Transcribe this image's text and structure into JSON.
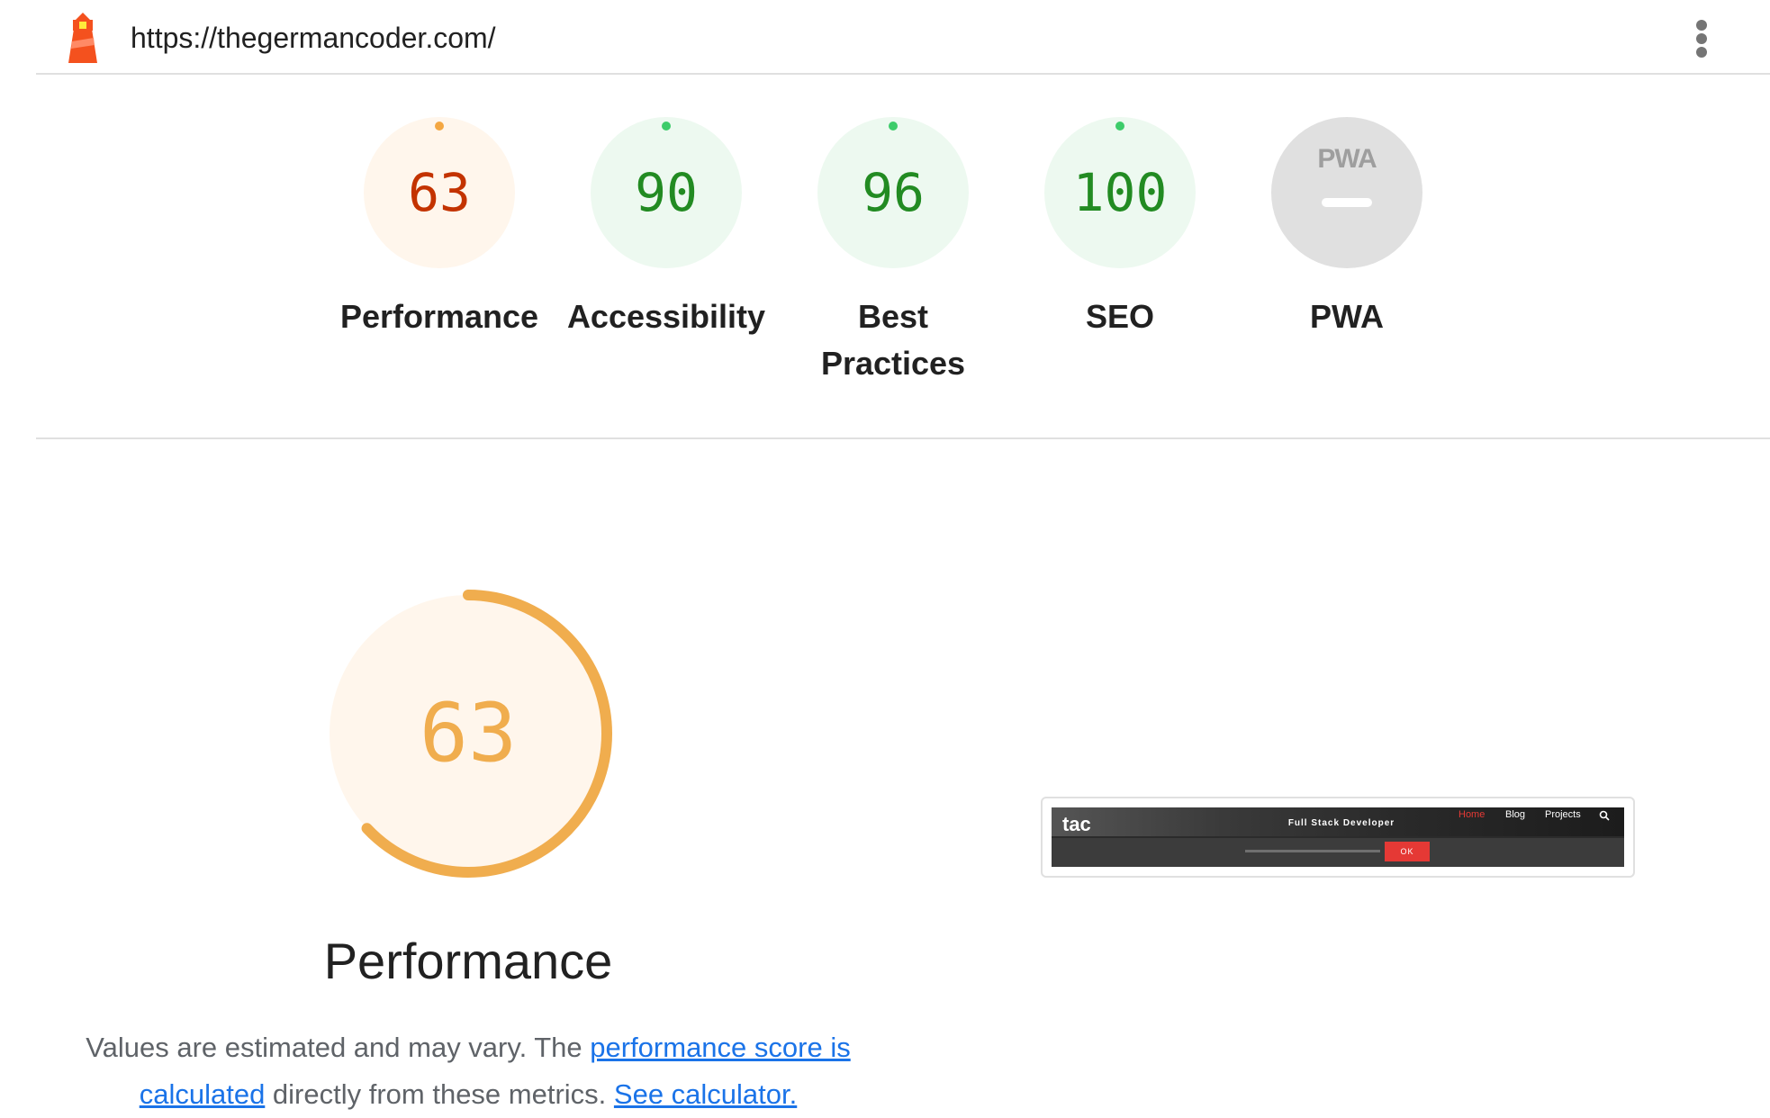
{
  "header": {
    "url": "https://thegermancoder.com/",
    "logo_icon": "lighthouse-icon",
    "menu_icon": "more-vert-icon"
  },
  "categories": [
    {
      "key": "performance",
      "score": "63",
      "label": "Performance",
      "status": "average",
      "color": "#c33300",
      "dot": "#f4a742",
      "bg": "#fff6ec"
    },
    {
      "key": "accessibility",
      "score": "90",
      "label": "Accessibility",
      "status": "pass",
      "color": "#228b22",
      "dot": "#3dcc6a",
      "bg": "#edf9f0"
    },
    {
      "key": "best-practices",
      "score": "96",
      "label": "Best Practices",
      "status": "pass",
      "color": "#228b22",
      "dot": "#3dcc6a",
      "bg": "#edf9f0"
    },
    {
      "key": "seo",
      "score": "100",
      "label": "SEO",
      "status": "pass",
      "color": "#228b22",
      "dot": "#3dcc6a",
      "bg": "#edf9f0"
    },
    {
      "key": "pwa",
      "score": "",
      "label": "PWA",
      "badge_text": "PWA",
      "status": "na",
      "bg": "#e0e0e0"
    }
  ],
  "performance_section": {
    "score": "63",
    "score_fraction": 0.63,
    "title": "Performance",
    "ring_color": "#f0ad4e",
    "bg_color": "#fff6ec",
    "desc_prefix": "Values are estimated and may vary. The ",
    "link_score_text": "performance score is calculated",
    "desc_middle": " directly from these metrics. ",
    "link_calculator_text": "See calculator."
  },
  "screenshot_thumb": {
    "brand": "tac",
    "subtitle": "Full Stack Developer",
    "nav": [
      "Home",
      "Blog",
      "Projects"
    ],
    "ok_label": "OK"
  }
}
